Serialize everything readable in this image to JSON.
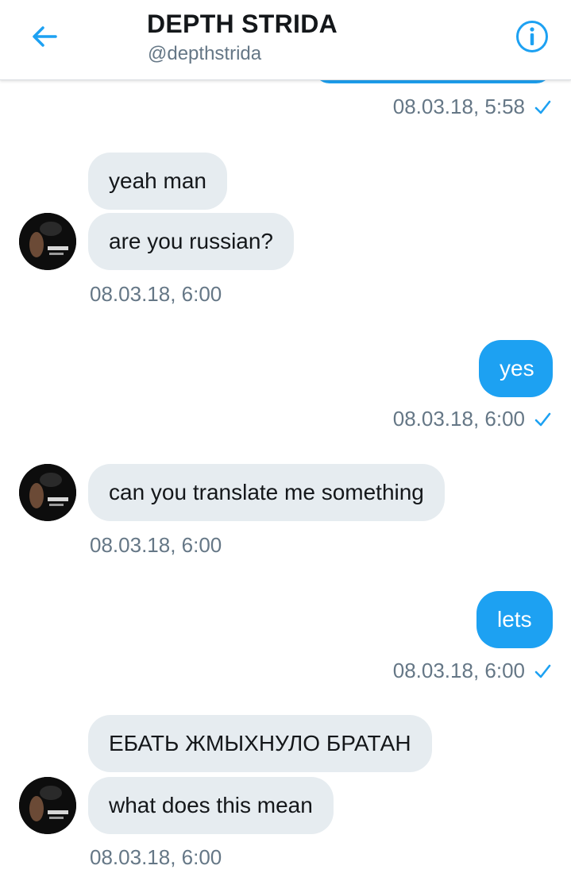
{
  "header": {
    "title": "DEPTH STRIDA",
    "handle": "@depthstrida",
    "back_icon": "arrow-left-icon",
    "info_icon": "info-circle-icon"
  },
  "colors": {
    "accent": "#1da1f2",
    "incoming_bubble": "#e6ecf0",
    "timestamp": "#657786",
    "text": "#14171a"
  },
  "conversation": [
    {
      "type": "timestamp",
      "side": "outgoing",
      "time": "08.03.18, 5:58",
      "status_icon": "check-icon"
    },
    {
      "type": "message",
      "side": "incoming",
      "text": "yeah man"
    },
    {
      "type": "message",
      "side": "incoming",
      "text": "are you russian?"
    },
    {
      "type": "timestamp",
      "side": "incoming",
      "time": "08.03.18, 6:00"
    },
    {
      "type": "message",
      "side": "outgoing",
      "text": "yes"
    },
    {
      "type": "timestamp",
      "side": "outgoing",
      "time": "08.03.18, 6:00",
      "status_icon": "check-icon"
    },
    {
      "type": "message",
      "side": "incoming",
      "text": "can you translate me something"
    },
    {
      "type": "timestamp",
      "side": "incoming",
      "time": "08.03.18, 6:00"
    },
    {
      "type": "message",
      "side": "outgoing",
      "text": "lets"
    },
    {
      "type": "timestamp",
      "side": "outgoing",
      "time": "08.03.18, 6:00",
      "status_icon": "check-icon"
    },
    {
      "type": "message",
      "side": "incoming",
      "text": "ЕБАТЬ ЖМЫХНУЛО БРАТАН"
    },
    {
      "type": "message",
      "side": "incoming",
      "text": "what does this mean"
    },
    {
      "type": "timestamp",
      "side": "incoming",
      "time": "08.03.18, 6:00"
    }
  ]
}
